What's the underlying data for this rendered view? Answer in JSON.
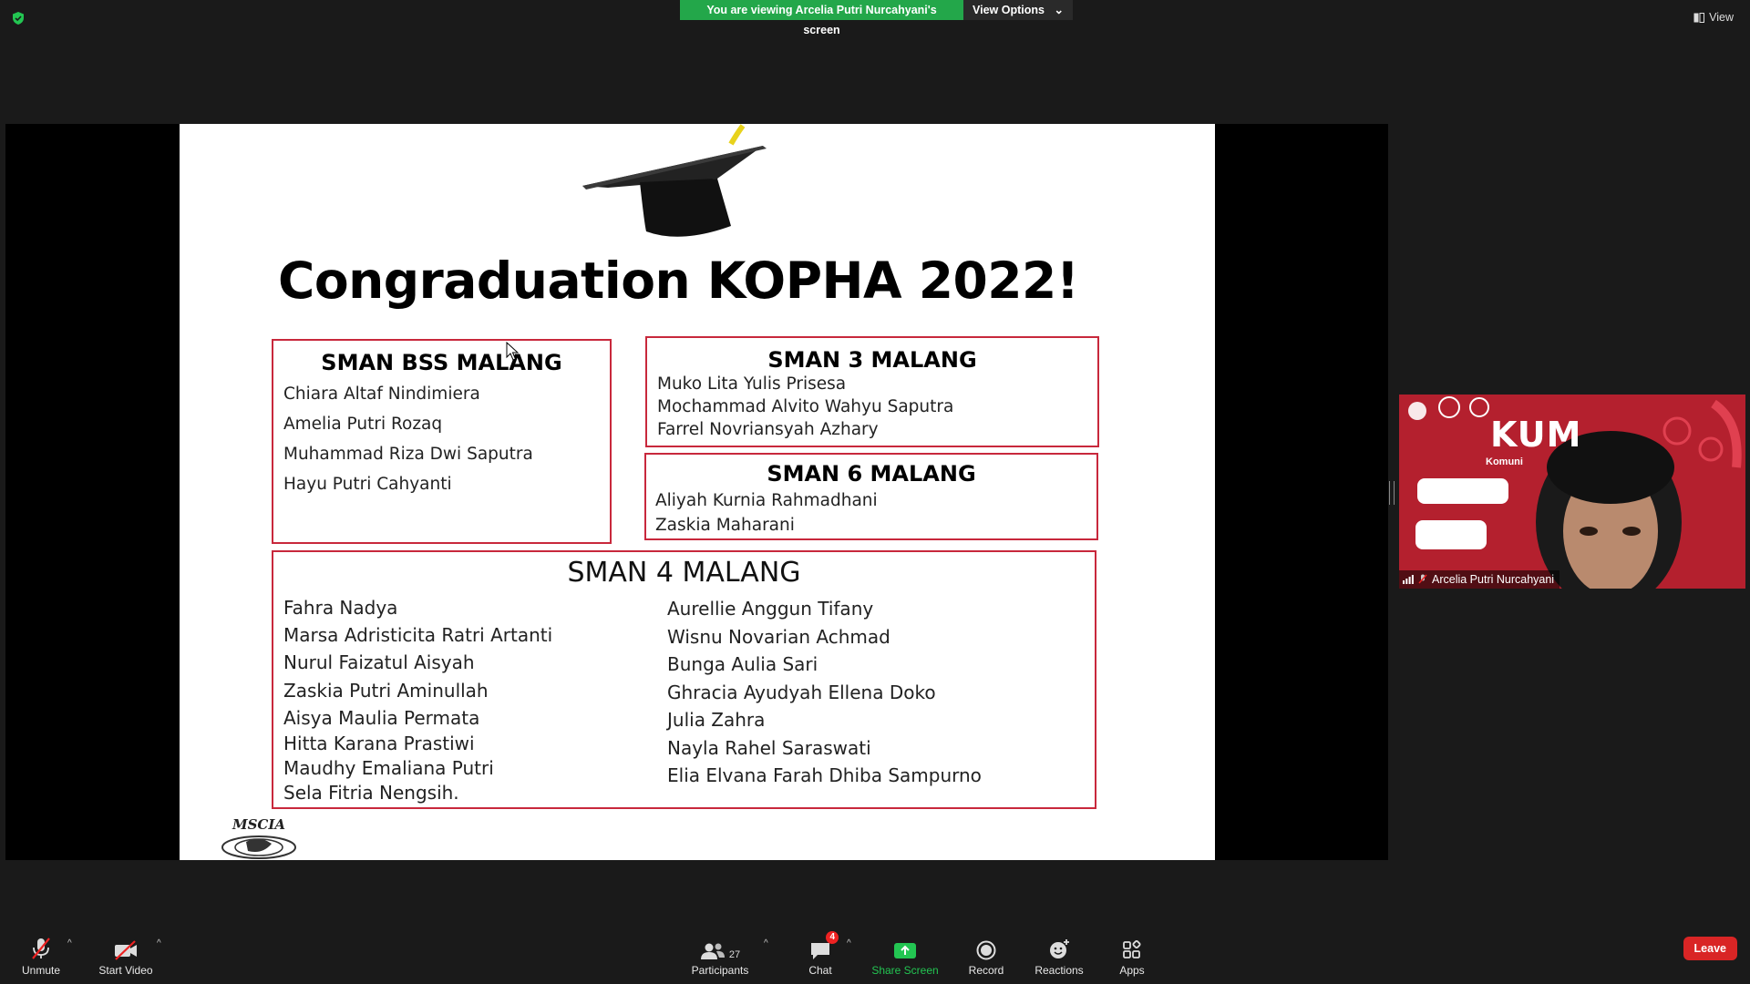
{
  "top_bar": {
    "viewing_banner": "You are viewing Arcelia Putri Nurcahyani's screen",
    "view_options": "View Options",
    "view_button": "View"
  },
  "slide": {
    "title": "Congraduation KOPHA 2022!",
    "schools": [
      {
        "name": "SMAN BSS MALANG",
        "members": [
          "Chiara Altaf Nindimiera",
          "Amelia Putri Rozaq",
          "Muhammad Riza Dwi Saputra",
          "Hayu Putri Cahyanti"
        ]
      },
      {
        "name": "SMAN 3 MALANG",
        "members": [
          "Muko Lita Yulis Prisesa",
          "Mochammad Alvito Wahyu Saputra",
          "Farrel Novriansyah Azhary"
        ]
      },
      {
        "name": "SMAN 6 MALANG",
        "members": [
          "Aliyah Kurnia Rahmadhani",
          "Zaskia Maharani"
        ]
      },
      {
        "name": "SMAN 4 MALANG",
        "members_col1": [
          "Fahra Nadya",
          "Marsa Adristicita Ratri Artanti",
          "Nurul Faizatul Aisyah",
          "Zaskia Putri Aminullah",
          "Aisya Maulia Permata",
          "Hitta Karana Prastiwi",
          "Maudhy Emaliana Putri",
          "Sela Fitria Nengsih."
        ],
        "members_col2": [
          "Aurellie Anggun Tifany",
          "Wisnu Novarian Achmad",
          "Bunga Aulia Sari",
          "Ghracia Ayudyah Ellena Doko",
          "Julia Zahra",
          "Nayla Rahel Saraswati",
          "Elia Elvana Farah Dhiba Sampurno"
        ]
      }
    ],
    "logo_text": "MSCIA"
  },
  "participant_tile": {
    "name": "Arcelia Putri Nurcahyani",
    "background_text": "KUM",
    "background_sub": "Komuni"
  },
  "toolbar": {
    "unmute": "Unmute",
    "start_video": "Start Video",
    "participants": "Participants",
    "participants_count": "27",
    "chat": "Chat",
    "chat_badge": "4",
    "share_screen": "Share Screen",
    "record": "Record",
    "reactions": "Reactions",
    "apps": "Apps",
    "leave": "Leave"
  },
  "colors": {
    "banner_green": "#23a74a",
    "share_green": "#23c552",
    "leave_red": "#d92525",
    "box_border": "#c8283c"
  }
}
